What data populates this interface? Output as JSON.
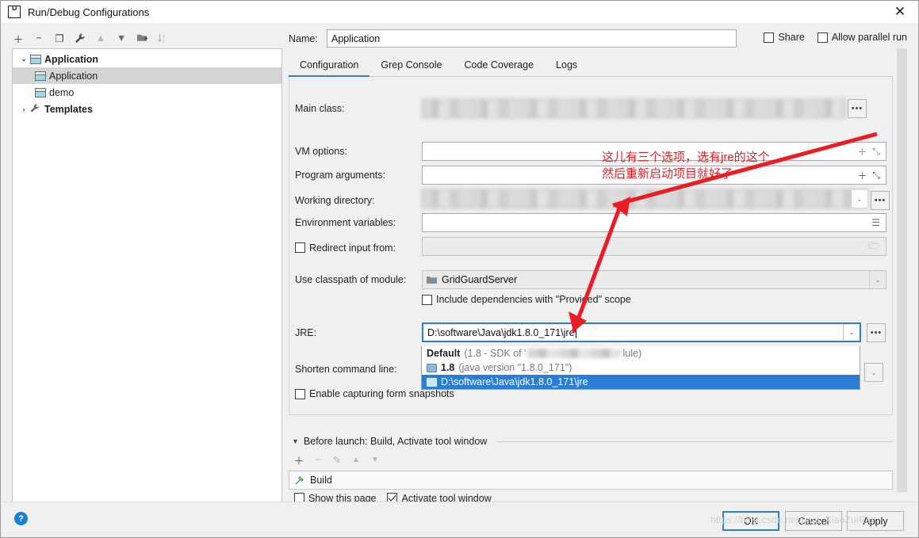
{
  "window": {
    "title": "Run/Debug Configurations",
    "logo": "intellij-idea-logo",
    "close": "✕"
  },
  "left_toolbar": {
    "items": [
      {
        "name": "add-configuration-button",
        "glyph": "＋",
        "dim": false
      },
      {
        "name": "remove-configuration-button",
        "glyph": "−",
        "dim": false
      },
      {
        "name": "copy-configuration-button",
        "glyph": "❐",
        "dim": false
      },
      {
        "name": "edit-templates-button",
        "glyph": "🔧",
        "dim": false
      },
      {
        "name": "move-up-button",
        "glyph": "▲",
        "dim": true
      },
      {
        "name": "move-down-button",
        "glyph": "▼",
        "dim": false
      },
      {
        "name": "create-folder-button",
        "glyph": "📁",
        "dim": false
      },
      {
        "name": "sort-configurations-button",
        "glyph": "↓ᵃᶻ",
        "dim": true
      }
    ]
  },
  "tree": {
    "rows": [
      {
        "label": "Application",
        "twisty": "⌄",
        "icon": "application-icon",
        "bold": true,
        "indent": 0,
        "selected": false
      },
      {
        "label": "Application",
        "twisty": "",
        "icon": "application-icon",
        "bold": false,
        "indent": 1,
        "selected": true
      },
      {
        "label": "demo",
        "twisty": "",
        "icon": "application-icon",
        "bold": false,
        "indent": 1,
        "selected": false
      },
      {
        "label": "Templates",
        "twisty": "›",
        "icon": "wrench-icon",
        "bold": true,
        "indent": 0,
        "selected": false
      }
    ]
  },
  "header": {
    "name_label": "Name:",
    "name_value": "Application",
    "share_label": "Share",
    "allow_parallel_label": "Allow parallel run"
  },
  "tabs": [
    {
      "label": "Configuration",
      "active": true
    },
    {
      "label": "Grep Console",
      "active": false
    },
    {
      "label": "Code Coverage",
      "active": false
    },
    {
      "label": "Logs",
      "active": false
    }
  ],
  "form": {
    "main_class_label": "Main class:",
    "main_class_value": "",
    "vm_options_label": "VM options:",
    "vm_options_value": "",
    "program_arguments_label": "Program arguments:",
    "program_arguments_value": "",
    "working_directory_label": "Working directory:",
    "working_directory_value": "",
    "environment_variables_label": "Environment variables:",
    "environment_variables_value": "",
    "redirect_input_label": "Redirect input from:",
    "use_classpath_label": "Use classpath of module:",
    "use_classpath_value": "GridGuardServer",
    "include_provided_label": "Include dependencies with \"Provided\" scope",
    "jre_label": "JRE:",
    "jre_value": "D:\\software\\Java\\jdk1.8.0_171\\jre",
    "shorten_command_line_label": "Shorten command line:",
    "shorten_command_line_value": "",
    "enable_form_snapshots_label": "Enable capturing form snapshots",
    "browse_glyph": "•••",
    "add_glyph": "＋",
    "expand_glyph": "⤡",
    "edit_glyph": "☰",
    "folder_glyph": "🗁",
    "chevron_glyph": "⌄"
  },
  "jre_dropdown": {
    "items": [
      {
        "label": "Default",
        "detail_prefix": "(1.8 - SDK of '",
        "detail_suffix": "lule)",
        "icon": "none",
        "selected": false,
        "blurred_middle": true
      },
      {
        "label": "1.8",
        "detail_prefix": "(java version \"1.8.0_171\")",
        "detail_suffix": "",
        "icon": "sdk-folder-icon",
        "selected": false,
        "blurred_middle": false
      },
      {
        "label": "D:\\software\\Java\\jdk1.8.0_171\\jre",
        "detail_prefix": "",
        "detail_suffix": "",
        "icon": "folder-icon",
        "selected": true,
        "blurred_middle": false
      }
    ]
  },
  "before_launch": {
    "title": "Before launch: Build, Activate tool window",
    "collapse_glyph": "▼",
    "toolbar": [
      {
        "name": "add-before-launch-task-button",
        "glyph": "＋",
        "dim": false
      },
      {
        "name": "remove-before-launch-task-button",
        "glyph": "−",
        "dim": true
      },
      {
        "name": "edit-before-launch-task-button",
        "glyph": "✎",
        "dim": true
      },
      {
        "name": "move-task-up-button",
        "glyph": "▲",
        "dim": true
      },
      {
        "name": "move-task-down-button",
        "glyph": "▼",
        "dim": true
      }
    ],
    "task": {
      "label": "Build",
      "icon": "hammer-icon"
    },
    "show_page_label": "Show this page",
    "activate_tool_window_label": "Activate tool window"
  },
  "footer": {
    "help_glyph": "?",
    "ok_label": "OK",
    "cancel_label": "Cancel",
    "apply_label": "Apply"
  },
  "annotation": {
    "line1": "这儿有三个选项，选有jre的这个",
    "line2": "然后重新启动项目就好了",
    "color": "#ec1c24"
  },
  "watermark": "https://blog.csdn.net/java_XiaoZuiRan",
  "colors": {
    "accent": "#2a7fd4",
    "tab_underline": "#3d7bbf",
    "annotation_red": "#ec1c24",
    "selection_blue": "#2a7fd4",
    "tree_selection": "#d4d4d4",
    "dialog_bg": "#f0f0f0"
  }
}
